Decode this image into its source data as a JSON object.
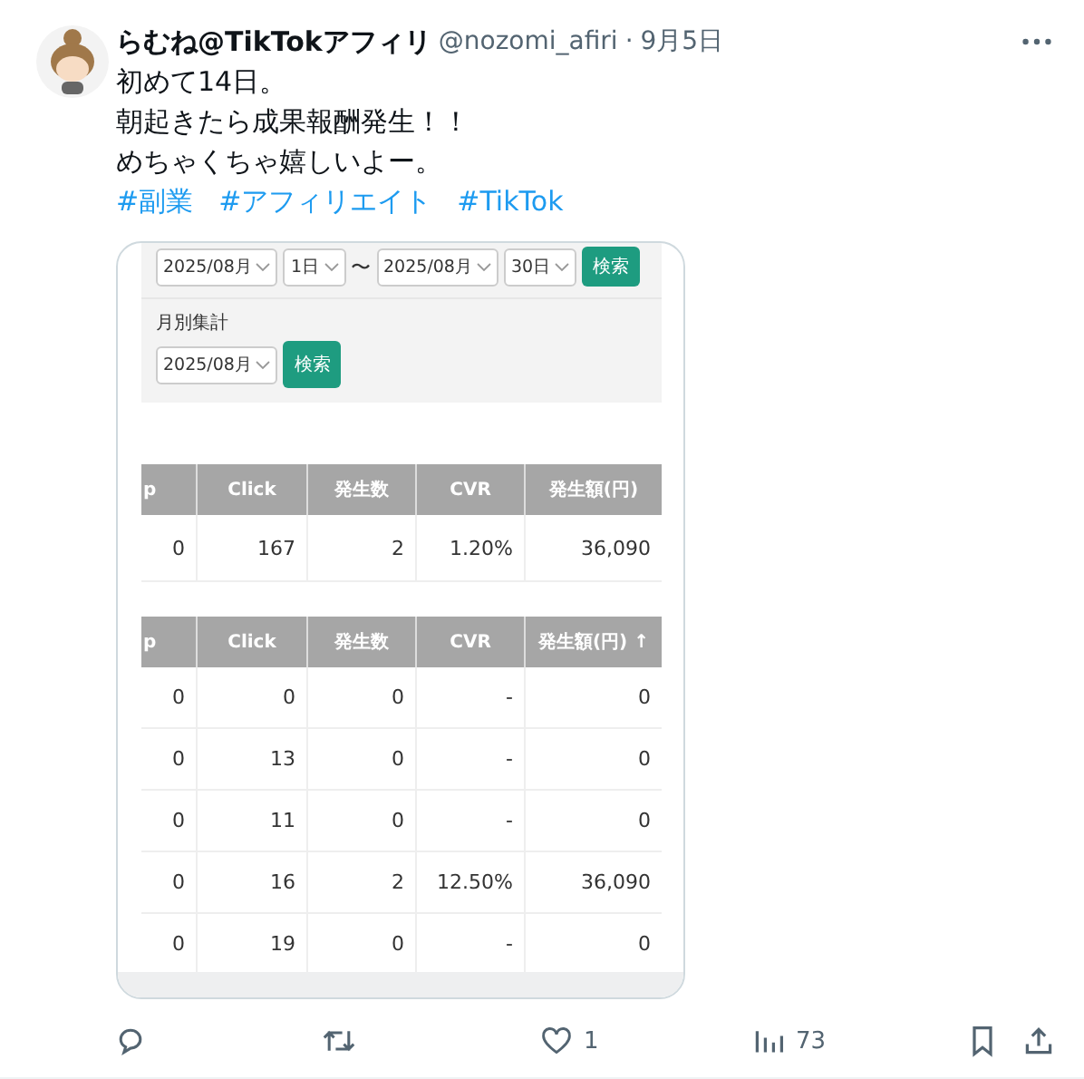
{
  "post": {
    "author": "らむね@TikTokアフィリ",
    "handle": "@nozomi_afiri",
    "separator": "·",
    "date": "9月5日",
    "lines": [
      "初めて14日。",
      "朝起きたら成果報酬発生！！",
      "めちゃくちゃ嬉しいよー。"
    ],
    "hashtags": [
      "#副業",
      "#アフィリエイト",
      "#TikTok"
    ]
  },
  "image": {
    "range_row": [
      {
        "kind": "select",
        "value": "2025/08月"
      },
      {
        "kind": "select",
        "value": "1日"
      },
      {
        "kind": "text",
        "value": "〜"
      },
      {
        "kind": "select",
        "value": "2025/08月"
      },
      {
        "kind": "select",
        "value": "30日"
      },
      {
        "kind": "button",
        "value": "検索"
      }
    ],
    "monthly_label": "月別集計",
    "monthly_select": "2025/08月",
    "monthly_button": "検索",
    "summary_table": {
      "columns": [
        "p",
        "Click",
        "発生数",
        "CVR",
        "発生額(円)"
      ],
      "rows": [
        [
          "0",
          "167",
          "2",
          "1.20%",
          "36,090"
        ]
      ]
    },
    "daily_table": {
      "columns": [
        "p",
        "Click",
        "発生数",
        "CVR",
        "発生額(円) ↑"
      ],
      "rows": [
        [
          "0",
          "0",
          "0",
          "-",
          "0"
        ],
        [
          "0",
          "13",
          "0",
          "-",
          "0"
        ],
        [
          "0",
          "11",
          "0",
          "-",
          "0"
        ],
        [
          "0",
          "16",
          "2",
          "12.50%",
          "36,090"
        ],
        [
          "0",
          "19",
          "0",
          "-",
          "0"
        ]
      ]
    }
  },
  "actions": [
    {
      "kind": "reply"
    },
    {
      "kind": "repost"
    },
    {
      "kind": "like",
      "count": "1"
    },
    {
      "kind": "views",
      "count": "73"
    },
    {
      "kind": "bookmark"
    },
    {
      "kind": "share"
    }
  ]
}
